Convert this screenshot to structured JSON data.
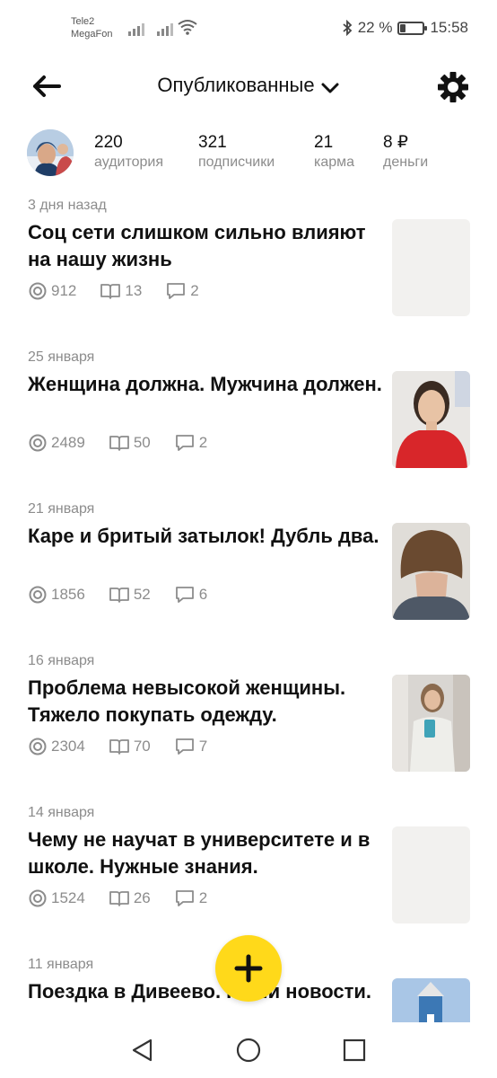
{
  "status_bar": {
    "carrier1": "Tele2",
    "carrier2": "MegaFon",
    "battery_text": "22 %",
    "time": "15:58",
    "battery_level": 0.22
  },
  "header": {
    "title": "Опубликованные"
  },
  "stats": [
    {
      "value": "220",
      "label": "аудитория"
    },
    {
      "value": "321",
      "label": "подписчики"
    },
    {
      "value": "21",
      "label": "карма"
    },
    {
      "value": "8 ₽",
      "label": "деньги"
    }
  ],
  "articles": [
    {
      "date": "3 дня назад",
      "title": "Соц сети слишком сильно влияют на нашу жизнь",
      "views": "912",
      "reads": "13",
      "comments": "2",
      "thumb": "blank"
    },
    {
      "date": "25 января",
      "title": "Женщина должна. Мужчина должен.",
      "views": "2489",
      "reads": "50",
      "comments": "2",
      "thumb": "woman-red-shirt"
    },
    {
      "date": "21 января",
      "title": "Каре и бритый затылок! Дубль два.",
      "views": "1856",
      "reads": "52",
      "comments": "6",
      "thumb": "haircut-back"
    },
    {
      "date": "16 января",
      "title": "Проблема невысокой женщины. Тяжело покупать одежду.",
      "views": "2304",
      "reads": "70",
      "comments": "7",
      "thumb": "woman-mirror-selfie"
    },
    {
      "date": "14 января",
      "title": "Чему не научат в университете и в школе. Нужные знания.",
      "views": "1524",
      "reads": "26",
      "comments": "2",
      "thumb": "blank"
    },
    {
      "date": "11 января",
      "title": "Поездка в Дивеево. Наши новости.",
      "thumb": "blue-building"
    }
  ],
  "colors": {
    "accent": "#ffd91a",
    "muted_text": "#8c8c8c",
    "thumb_placeholder": "#f2f1ef"
  }
}
